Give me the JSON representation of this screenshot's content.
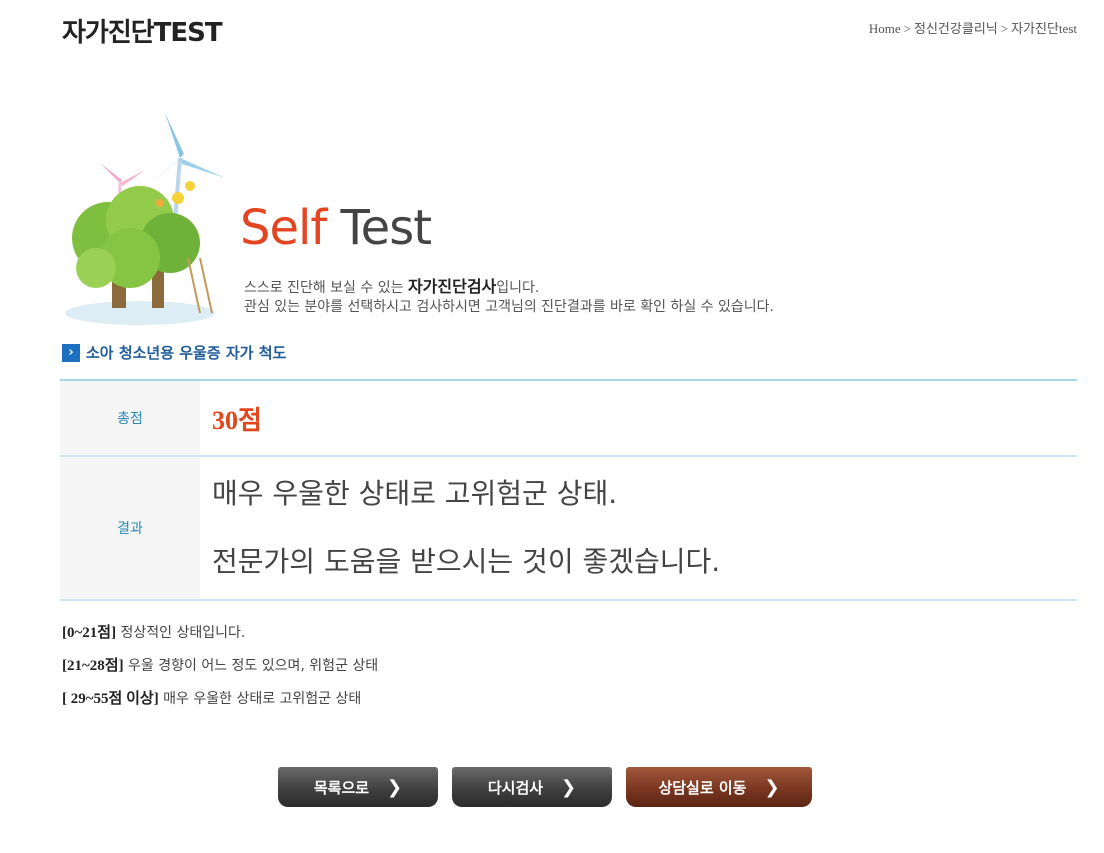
{
  "page": {
    "title": "자가진단TEST",
    "breadcrumb": [
      "Home",
      "정신건강클리닉",
      "자가진단test"
    ],
    "breadcrumb_sep": ">"
  },
  "banner": {
    "title_word1": "Self",
    "title_word2": "Test",
    "desc_line1_pre": "스스로 진단해 보실 수 있는 ",
    "desc_line1_bold": "자가진단검사",
    "desc_line1_post": "입니다.",
    "desc_line2": "관심 있는 분야를 선택하시고 검사하시면 고객님의 진단결과를 바로 확인 하실 수 있습니다."
  },
  "section": {
    "title": "소아 청소년용 우울증 자가 척도"
  },
  "result": {
    "score_label": "총점",
    "score_value": "30점",
    "result_label": "결과",
    "result_line1": "매우 우울한 상태로 고위험군 상태.",
    "result_line2": "전문가의 도움을 받으시는 것이 좋겠습니다."
  },
  "criteria": [
    {
      "range": "[0~21점]",
      "text": " 정상적인 상태입니다."
    },
    {
      "range": "[21~28점]",
      "text": " 우울 경향이 어느 정도 있으며, 위험군 상태"
    },
    {
      "range": "[ 29~55점 이상]",
      "text": " 매우 우울한 상태로 고위험군 상태"
    }
  ],
  "buttons": {
    "list": "목록으로",
    "retry": "다시검사",
    "counsel": "상담실로 이동",
    "chevron": "❯"
  },
  "colors": {
    "accent_red": "#e34422",
    "section_blue": "#1f5c99",
    "table_label": "#2a8ab4",
    "counsel_button": "#7a3620"
  },
  "icons": [
    "section-arrow-icon",
    "chevron-right-icon",
    "windmill-tree-illustration"
  ]
}
